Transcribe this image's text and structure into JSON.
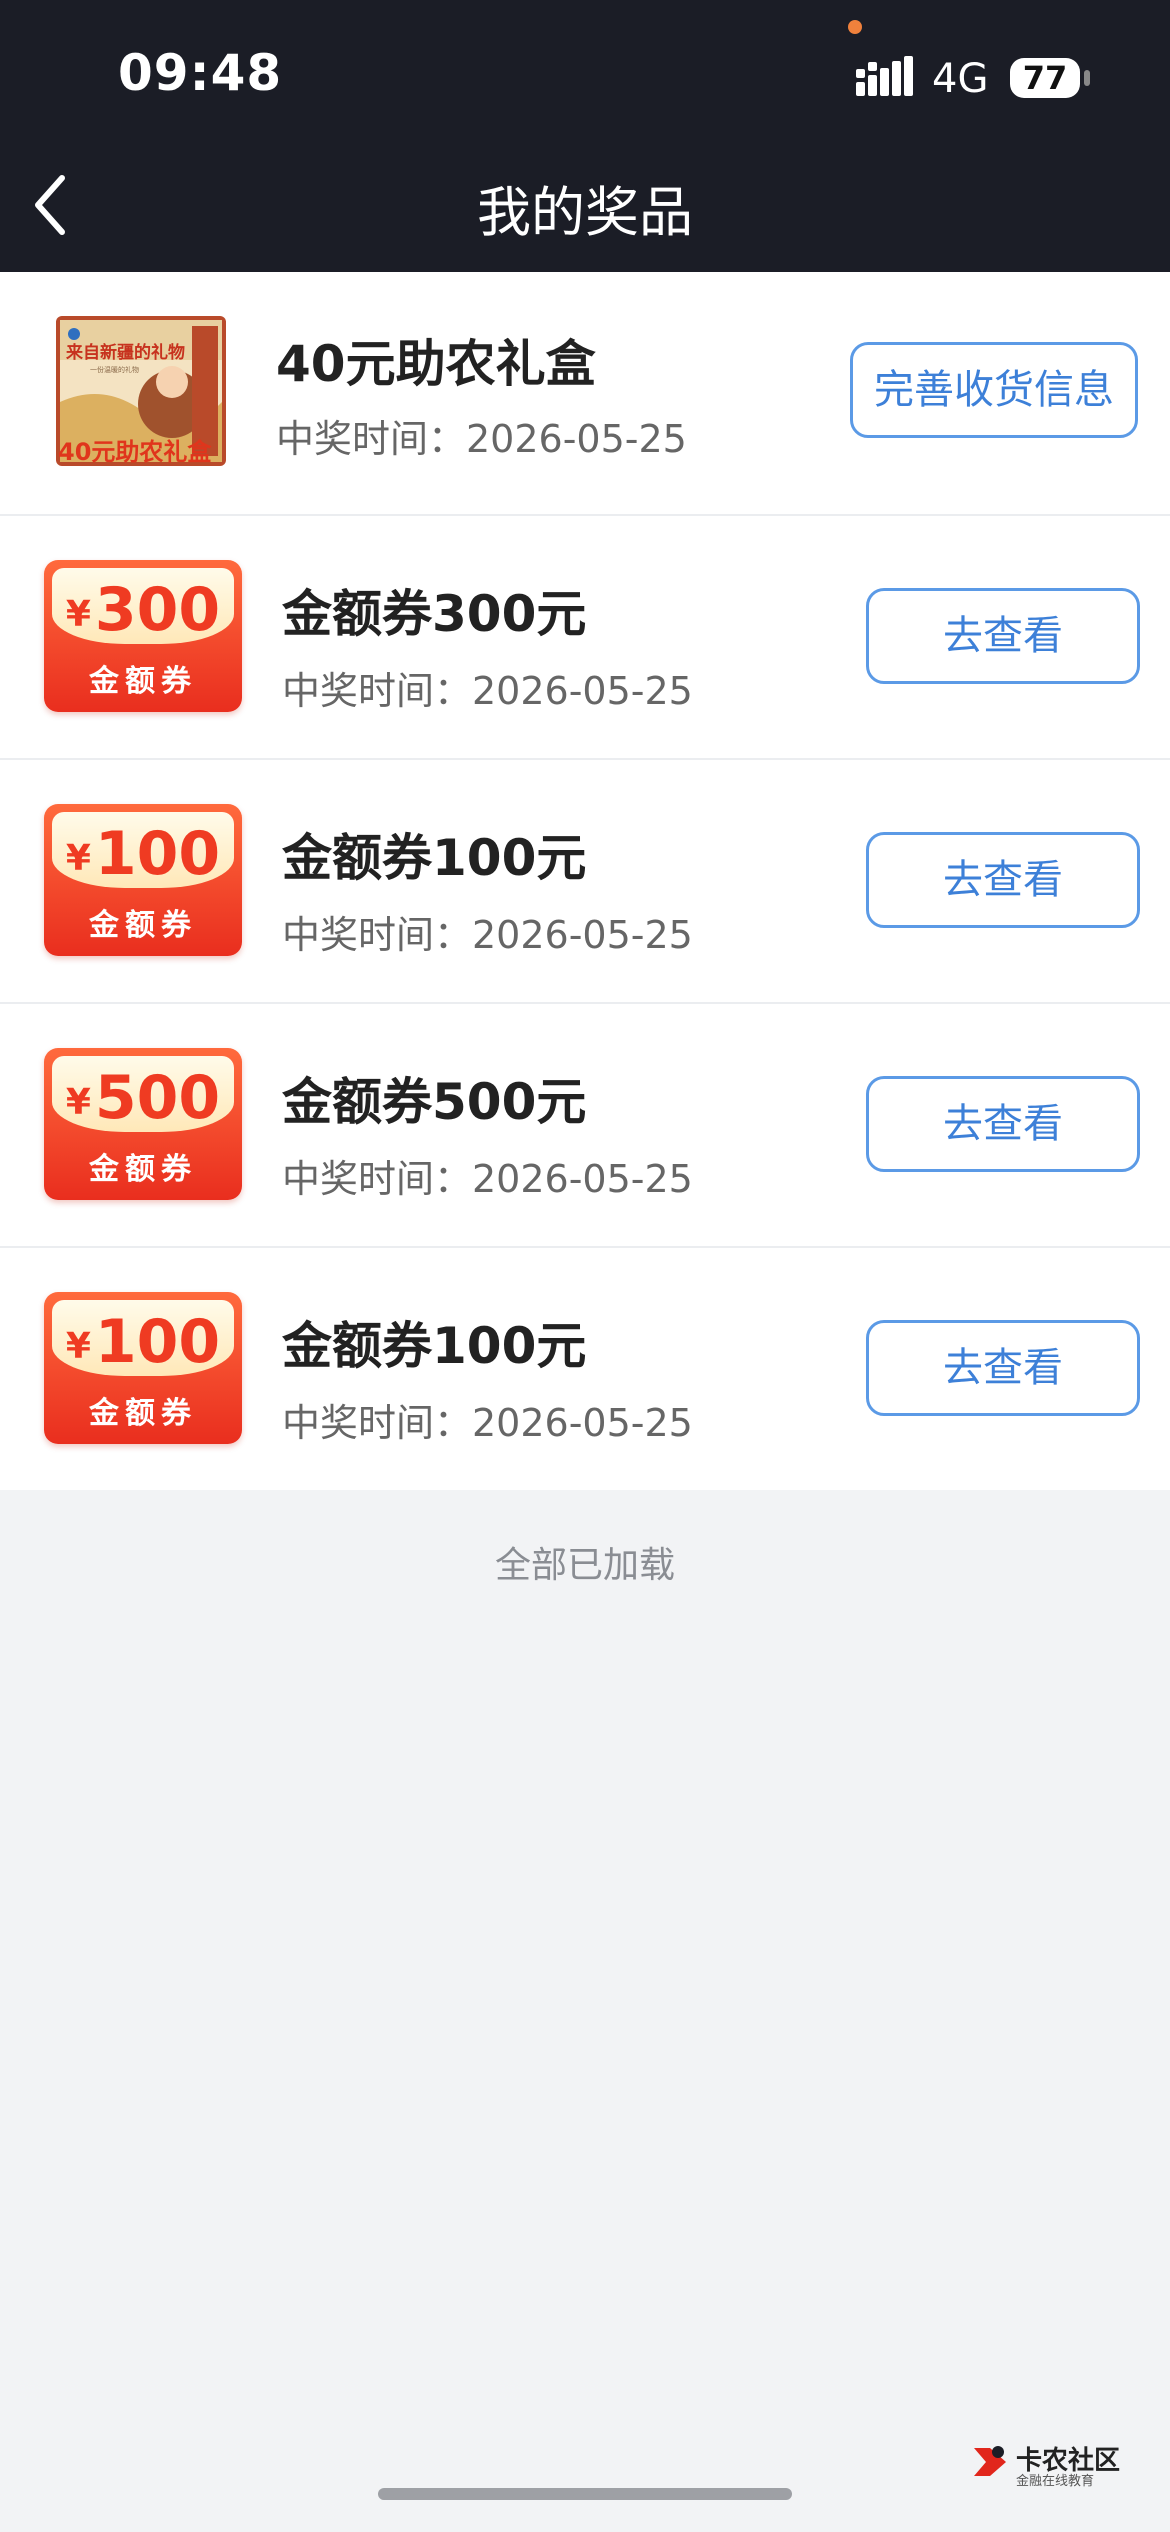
{
  "status_bar": {
    "time": "09:48",
    "network": "4G",
    "battery": "77"
  },
  "nav": {
    "title": "我的奖品",
    "back_icon": "chevron-left-icon"
  },
  "prizes": [
    {
      "name": "40元助农礼盒",
      "time": "中奖时间：2026-05-25",
      "action": "完善收货信息",
      "image": {
        "banner": "来自新疆的礼物",
        "subtitle": "一份温暖的礼物",
        "caption": "40元助农礼盒"
      }
    },
    {
      "name": "金额券300元",
      "time": "中奖时间：2026-05-25",
      "action": "去查看",
      "voucher": {
        "currency": "¥",
        "amount": "300",
        "label": "金额券"
      }
    },
    {
      "name": "金额券100元",
      "time": "中奖时间：2026-05-25",
      "action": "去查看",
      "voucher": {
        "currency": "¥",
        "amount": "100",
        "label": "金额券"
      }
    },
    {
      "name": "金额券500元",
      "time": "中奖时间：2026-05-25",
      "action": "去查看",
      "voucher": {
        "currency": "¥",
        "amount": "500",
        "label": "金额券"
      }
    },
    {
      "name": "金额券100元",
      "time": "中奖时间：2026-05-25",
      "action": "去查看",
      "voucher": {
        "currency": "¥",
        "amount": "100",
        "label": "金额券"
      }
    }
  ],
  "footer": {
    "loaded_text": "全部已加载"
  },
  "watermark": {
    "title": "卡农社区",
    "subtitle": "金融在线教育"
  },
  "colors": {
    "header_bg": "#1b1d26",
    "page_bg": "#f2f3f5",
    "button_border": "#5b9ae6",
    "button_text": "#3d80d8",
    "voucher_red": "#ef3b22"
  }
}
